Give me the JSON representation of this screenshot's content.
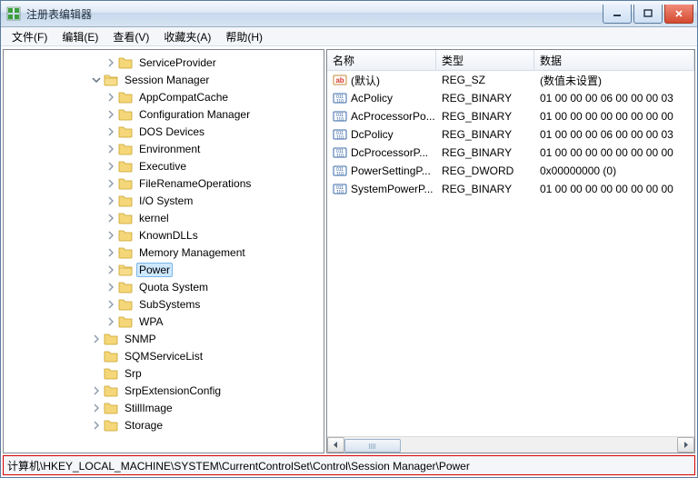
{
  "window": {
    "title": "注册表编辑器"
  },
  "menu": {
    "file": "文件(F)",
    "edit": "编辑(E)",
    "view": "查看(V)",
    "favorites": "收藏夹(A)",
    "help": "帮助(H)"
  },
  "tree": {
    "items": [
      {
        "depth": 7,
        "twisty": "closed",
        "label": "ServiceProvider"
      },
      {
        "depth": 6,
        "twisty": "open",
        "label": "Session Manager"
      },
      {
        "depth": 7,
        "twisty": "closed",
        "label": "AppCompatCache"
      },
      {
        "depth": 7,
        "twisty": "closed",
        "label": "Configuration Manager"
      },
      {
        "depth": 7,
        "twisty": "closed",
        "label": "DOS Devices"
      },
      {
        "depth": 7,
        "twisty": "closed",
        "label": "Environment"
      },
      {
        "depth": 7,
        "twisty": "closed",
        "label": "Executive"
      },
      {
        "depth": 7,
        "twisty": "closed",
        "label": "FileRenameOperations"
      },
      {
        "depth": 7,
        "twisty": "closed",
        "label": "I/O System"
      },
      {
        "depth": 7,
        "twisty": "closed",
        "label": "kernel"
      },
      {
        "depth": 7,
        "twisty": "closed",
        "label": "KnownDLLs"
      },
      {
        "depth": 7,
        "twisty": "closed",
        "label": "Memory Management"
      },
      {
        "depth": 7,
        "twisty": "closed",
        "label": "Power",
        "selected": true
      },
      {
        "depth": 7,
        "twisty": "closed",
        "label": "Quota System"
      },
      {
        "depth": 7,
        "twisty": "closed",
        "label": "SubSystems"
      },
      {
        "depth": 7,
        "twisty": "closed",
        "label": "WPA"
      },
      {
        "depth": 6,
        "twisty": "closed",
        "label": "SNMP"
      },
      {
        "depth": 6,
        "twisty": "none",
        "label": "SQMServiceList"
      },
      {
        "depth": 6,
        "twisty": "none",
        "label": "Srp"
      },
      {
        "depth": 6,
        "twisty": "closed",
        "label": "SrpExtensionConfig"
      },
      {
        "depth": 6,
        "twisty": "closed",
        "label": "StillImage"
      },
      {
        "depth": 6,
        "twisty": "closed",
        "label": "Storage"
      }
    ]
  },
  "list": {
    "columns": {
      "name": "名称",
      "type": "类型",
      "data": "数据"
    },
    "rows": [
      {
        "icon": "str",
        "name": "(默认)",
        "type": "REG_SZ",
        "data": "(数值未设置)"
      },
      {
        "icon": "bin",
        "name": "AcPolicy",
        "type": "REG_BINARY",
        "data": "01 00 00 00 06 00 00 00 03"
      },
      {
        "icon": "bin",
        "name": "AcProcessorPo...",
        "type": "REG_BINARY",
        "data": "01 00 00 00 00 00 00 00 00"
      },
      {
        "icon": "bin",
        "name": "DcPolicy",
        "type": "REG_BINARY",
        "data": "01 00 00 00 06 00 00 00 03"
      },
      {
        "icon": "bin",
        "name": "DcProcessorP...",
        "type": "REG_BINARY",
        "data": "01 00 00 00 00 00 00 00 00"
      },
      {
        "icon": "bin",
        "name": "PowerSettingP...",
        "type": "REG_DWORD",
        "data": "0x00000000 (0)"
      },
      {
        "icon": "bin",
        "name": "SystemPowerP...",
        "type": "REG_BINARY",
        "data": "01 00 00 00 00 00 00 00 00"
      }
    ]
  },
  "statusbar": {
    "path": "计算机\\HKEY_LOCAL_MACHINE\\SYSTEM\\CurrentControlSet\\Control\\Session Manager\\Power"
  }
}
